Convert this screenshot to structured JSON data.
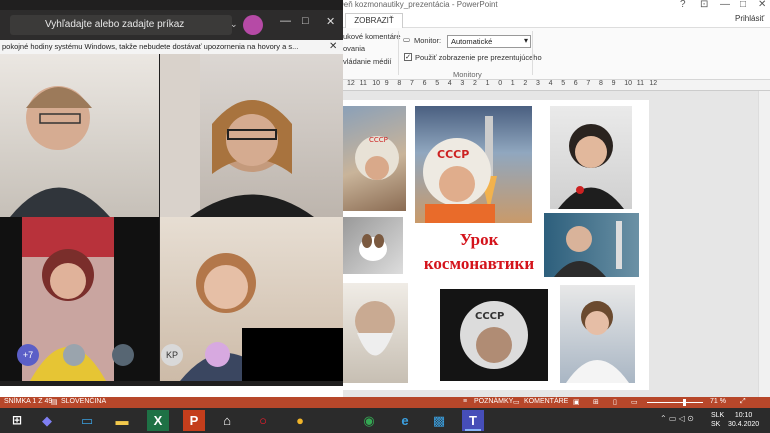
{
  "powerpoint": {
    "document_title": "Deň kozmonautiky_prezentácia - PowerPoint",
    "active_tab": "ZOBRAZIŤ",
    "sign_in": "Prihlásiť",
    "ribbon": {
      "speaker_notes": "ukové komentáre",
      "rehearse": "ovania",
      "recording": "vládanie médií",
      "monitor_label": "Monitor:",
      "monitor_value": "Automatické",
      "presenter_view": "Použiť zobrazenie pre prezentujúceho",
      "group_label": "Monitory"
    },
    "ruler_ticks": [
      "12",
      "11",
      "10",
      "9",
      "8",
      "7",
      "6",
      "5",
      "4",
      "3",
      "2",
      "1",
      "0",
      "1",
      "2",
      "3",
      "4",
      "5",
      "6",
      "7",
      "8",
      "9",
      "10",
      "11",
      "12"
    ],
    "slide": {
      "title_line1": "Урок",
      "title_line2": "космонавтики",
      "title_color": "#d4131b"
    },
    "status": {
      "slide_counter": "SNÍMKA 1 Z 49",
      "language": "SLOVENČINA",
      "notes": "POZNÁMKY",
      "comments": "KOMENTÁRE",
      "zoom": "71 %"
    }
  },
  "taskbar": {
    "icons": [
      "windows-icon",
      "cortana-icon",
      "task-view-icon",
      "file-explorer-icon",
      "excel-icon",
      "powerpoint-icon",
      "home-icon",
      "opera-icon",
      "sound-recorder-icon",
      "chrome-icon",
      "edge-icon",
      "photos-icon",
      "teams-icon"
    ],
    "lang_line1": "SLK",
    "lang_line2": "SK",
    "time": "10:10",
    "date": "30.4.2020"
  },
  "teams": {
    "search_placeholder": "Vyhľadajte alebo zadajte príkaz",
    "banner_text": "pokojné hodiny systému Windows, takže nebudete dostávať upozornenia na hovory a s...",
    "overflow_count": "+7",
    "participant_initials": "KP",
    "accent": "#6264a7"
  },
  "colors": {
    "powerpoint_brand": "#b7472a",
    "teams_bg": "#201f1f"
  }
}
